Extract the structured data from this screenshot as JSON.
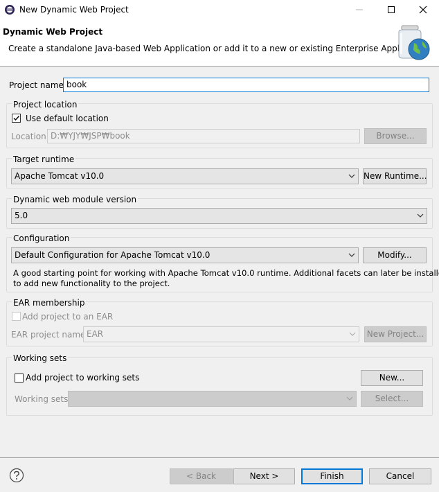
{
  "window": {
    "title": "New Dynamic Web Project"
  },
  "header": {
    "title": "Dynamic Web Project",
    "description": "Create a standalone Java-based Web Application or add it to a new or existing Enterprise Application."
  },
  "project_name": {
    "label": "Project name:",
    "value": "book"
  },
  "project_location": {
    "group_label": "Project location",
    "use_default_label": "Use default location",
    "use_default_checked": true,
    "location_label": "Location:",
    "location_value": "D:₩YJY₩JSP₩book",
    "browse_label": "Browse..."
  },
  "target_runtime": {
    "group_label": "Target runtime",
    "selected": "Apache Tomcat v10.0",
    "new_runtime_label": "New Runtime..."
  },
  "module_version": {
    "group_label": "Dynamic web module version",
    "selected": "5.0"
  },
  "configuration": {
    "group_label": "Configuration",
    "selected": "Default Configuration for Apache Tomcat v10.0",
    "modify_label": "Modify...",
    "description_line1": "A good starting point for working with Apache Tomcat v10.0 runtime. Additional facets can later be installed",
    "description_line2": "to add new functionality to the project."
  },
  "ear": {
    "group_label": "EAR membership",
    "add_label": "Add project to an EAR",
    "project_name_label": "EAR project name:",
    "project_name_value": "EAR",
    "new_project_label": "New Project..."
  },
  "working_sets": {
    "group_label": "Working sets",
    "add_label": "Add project to working sets",
    "new_label": "New...",
    "sets_label": "Working sets:",
    "select_label": "Select..."
  },
  "footer": {
    "back_label": "< Back",
    "next_label": "Next >",
    "finish_label": "Finish",
    "cancel_label": "Cancel"
  },
  "icons": {
    "app": "eclipse-icon",
    "header": "web-project-jar-globe-icon",
    "help": "help-icon"
  }
}
